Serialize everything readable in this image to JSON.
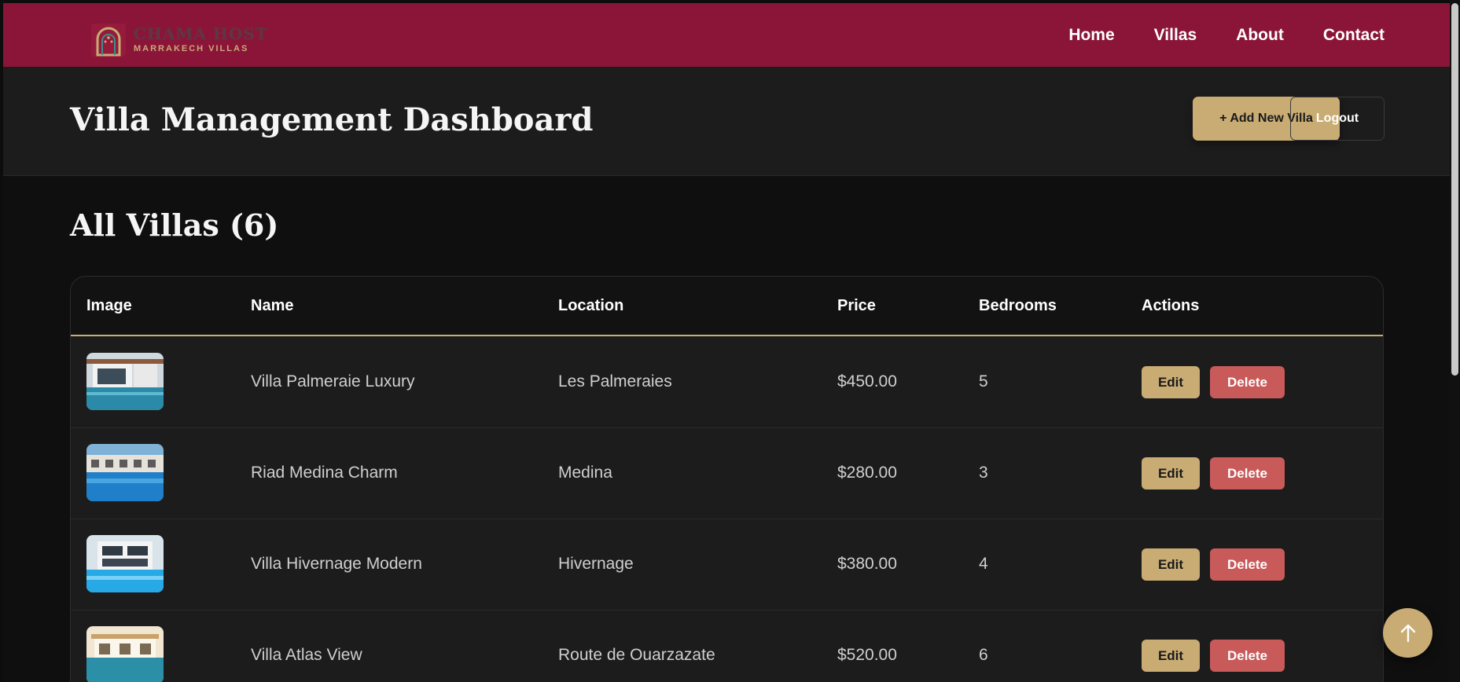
{
  "brand": {
    "name": "CHAMA HOST",
    "tagline": "MARRAKECH VILLAS",
    "icon": "arch-logo-icon"
  },
  "nav": [
    "Home",
    "Villas",
    "About",
    "Contact"
  ],
  "dashboard": {
    "title": "Villa Management Dashboard",
    "add_label": "+ Add New Villa",
    "logout_label": "Logout"
  },
  "section": {
    "title": "All Villas (6)"
  },
  "table": {
    "headers": [
      "Image",
      "Name",
      "Location",
      "Price",
      "Bedrooms",
      "Actions"
    ],
    "rows": [
      {
        "name": "Villa Palmeraie Luxury",
        "location": "Les Palmeraies",
        "price": "$450.00",
        "bedrooms": "5",
        "edit": "Edit",
        "delete": "Delete"
      },
      {
        "name": "Riad Medina Charm",
        "location": "Medina",
        "price": "$280.00",
        "bedrooms": "3",
        "edit": "Edit",
        "delete": "Delete"
      },
      {
        "name": "Villa Hivernage Modern",
        "location": "Hivernage",
        "price": "$380.00",
        "bedrooms": "4",
        "edit": "Edit",
        "delete": "Delete"
      },
      {
        "name": "Villa Atlas View",
        "location": "Route de Ouarzazate",
        "price": "$520.00",
        "bedrooms": "6",
        "edit": "Edit",
        "delete": "Delete"
      }
    ]
  },
  "colors": {
    "header": "#8b1538",
    "accent": "#c9ab74",
    "danger": "#c85a5a",
    "panel": "#1c1c1c",
    "background": "#0f0f0f"
  },
  "scroll_top": {
    "icon": "arrow-up-icon"
  }
}
